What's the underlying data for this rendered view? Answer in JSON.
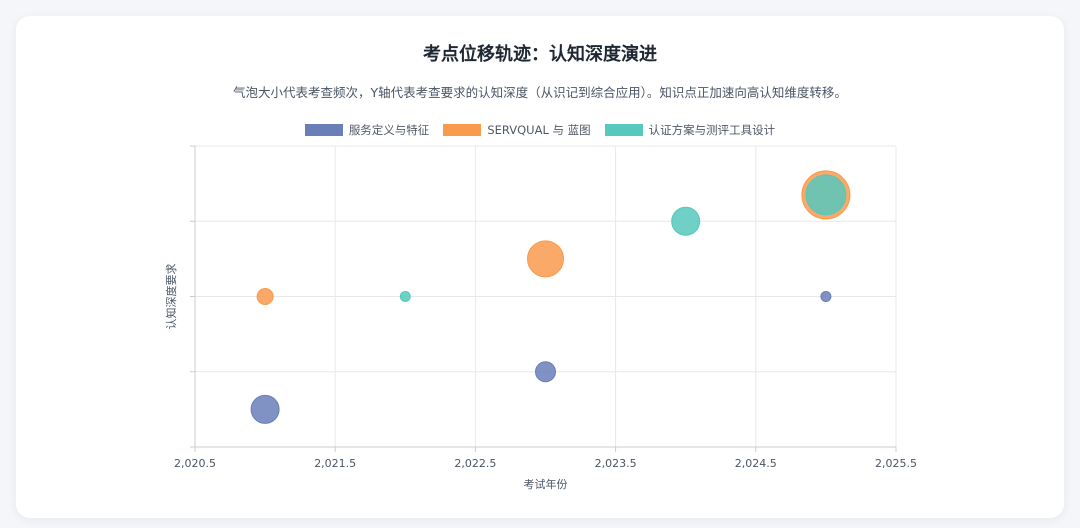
{
  "chart_data": {
    "type": "scatter",
    "title": "考点位移轨迹：认知深度演进",
    "subtitle": "气泡大小代表考查频次，Y轴代表考查要求的认知深度（从识记到综合应用）。知识点正加速向高认知维度转移。",
    "xlabel": "考试年份",
    "ylabel": "认知深度要求",
    "xlim": [
      2020.5,
      2025.5
    ],
    "ylim": [
      0.5,
      4.5
    ],
    "x_ticks": [
      "2,020.5",
      "2,021.5",
      "2,022.5",
      "2,023.5",
      "2,024.5",
      "2,025.5"
    ],
    "grid": true,
    "legend_position": "top",
    "series": [
      {
        "name": "服务定义与特征",
        "color": "#6a7eb8",
        "points": [
          {
            "x": 2021,
            "y": 1,
            "size": 14
          },
          {
            "x": 2023,
            "y": 1.5,
            "size": 10
          },
          {
            "x": 2025,
            "y": 2.5,
            "size": 5
          }
        ]
      },
      {
        "name": "SERVQUAL 与 蓝图",
        "color": "#fa9a4d",
        "points": [
          {
            "x": 2021,
            "y": 2.5,
            "size": 8
          },
          {
            "x": 2023,
            "y": 3.0,
            "size": 18
          },
          {
            "x": 2025,
            "y": 3.85,
            "size": 24
          }
        ]
      },
      {
        "name": "认证方案与测评工具设计",
        "color": "#56c8bd",
        "points": [
          {
            "x": 2022,
            "y": 2.5,
            "size": 5
          },
          {
            "x": 2024,
            "y": 3.5,
            "size": 14
          },
          {
            "x": 2025,
            "y": 3.85,
            "size": 20
          }
        ]
      }
    ]
  }
}
